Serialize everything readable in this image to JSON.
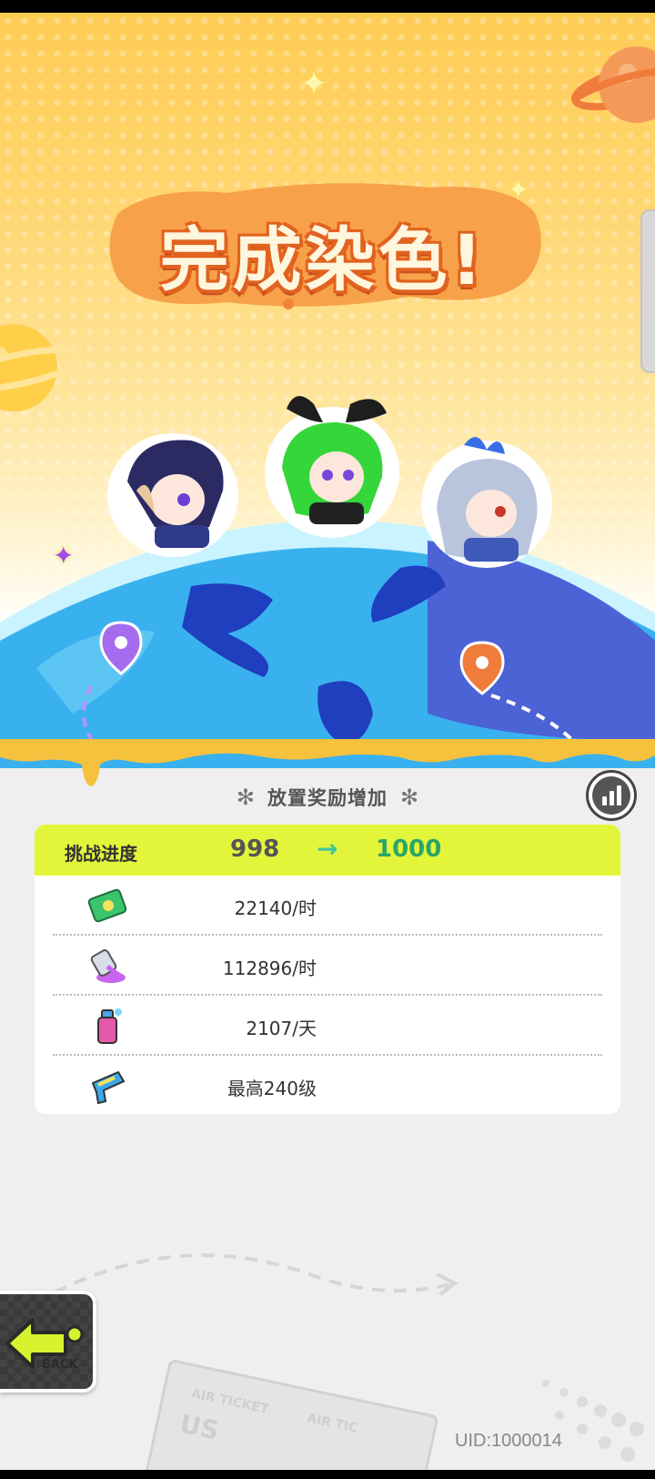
{
  "title": "完成染色!",
  "rewards": {
    "header": "放置奖励增加"
  },
  "progress": {
    "label": "挑战进度",
    "from": "998",
    "arrow": "→",
    "to": "1000"
  },
  "rows": [
    {
      "icon": "cash-icon",
      "value": "22140/时"
    },
    {
      "icon": "paint-bucket-icon",
      "value": "112896/时"
    },
    {
      "icon": "spray-can-icon",
      "value": "2107/天"
    },
    {
      "icon": "paint-gun-icon",
      "value": "最高240级"
    }
  ],
  "back": {
    "label": "BACK"
  },
  "uid": "UID:1000014",
  "colors": {
    "accent_yellow": "#e3f53a",
    "title_orange": "#e2621f",
    "progress_green": "#2ba567"
  }
}
